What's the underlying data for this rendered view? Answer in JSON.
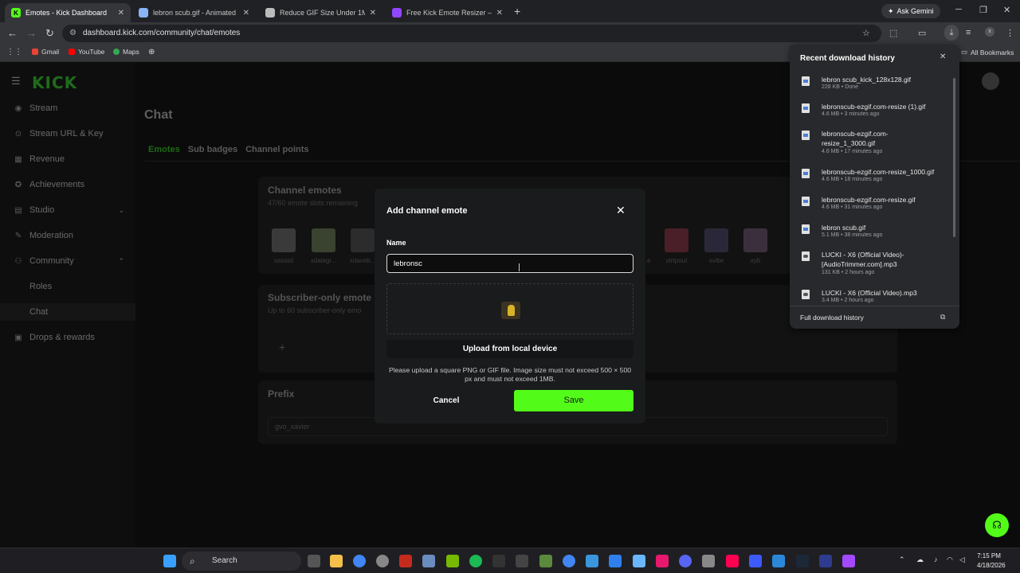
{
  "browser": {
    "tabs": [
      {
        "title": "Emotes - Kick Dashboard",
        "icon": "kick-icon",
        "active": true
      },
      {
        "title": "lebron scub.gif - Animated ima",
        "icon": "ezgif-icon",
        "active": false
      },
      {
        "title": "Reduce GIF Size Under 1MB",
        "icon": "tool-icon",
        "active": false
      },
      {
        "title": "Free Kick Emote Resizer – Resiz",
        "icon": "twitch-style-icon",
        "active": false
      }
    ],
    "ask_gemini": "Ask Gemini",
    "url": "dashboard.kick.com/community/chat/emotes",
    "bookmarks": [
      {
        "label": "Gmail"
      },
      {
        "label": "YouTube"
      },
      {
        "label": "Maps"
      }
    ],
    "all_bookmarks": "All Bookmarks"
  },
  "sidebar": {
    "items": [
      {
        "label": "Stream",
        "icon": "stream-icon"
      },
      {
        "label": "Stream URL & Key",
        "icon": "key-icon"
      },
      {
        "label": "Revenue",
        "icon": "revenue-icon"
      },
      {
        "label": "Achievements",
        "icon": "trophy-icon"
      },
      {
        "label": "Studio",
        "icon": "studio-icon"
      },
      {
        "label": "Moderation",
        "icon": "wrench-icon"
      },
      {
        "label": "Community",
        "icon": "community-icon"
      },
      {
        "label": "Roles",
        "icon": ""
      },
      {
        "label": "Chat",
        "icon": ""
      },
      {
        "label": "Drops & rewards",
        "icon": "gift-icon"
      }
    ]
  },
  "main": {
    "title": "Chat",
    "tabs": [
      "Emotes",
      "Sub badges",
      "Channel points"
    ],
    "channel_emotes": {
      "title": "Channel emotes",
      "subtitle": "47/60 emote slots remaining",
      "emotes_left": [
        {
          "label": "xassist",
          "color": "#3a3a3a"
        },
        {
          "label": "xdalegr...",
          "color": "#3a4230"
        },
        {
          "label": "xdaveb...",
          "color": "#2c2c2c"
        }
      ],
      "emotes_right": [
        {
          "label": "...e",
          "color": "#202020"
        },
        {
          "label": "xtrtpout",
          "color": "#4a1f28"
        },
        {
          "label": "xvibe",
          "color": "#2a2838"
        },
        {
          "label": "xyb",
          "color": "#3b2f3d"
        }
      ]
    },
    "subscriber_emotes": {
      "title": "Subscriber-only emote",
      "subtitle": "Up to 60 subscriber-only emo"
    },
    "prefix": {
      "title": "Prefix",
      "value": "gvo_xavier"
    }
  },
  "modal": {
    "title": "Add channel emote",
    "name_label": "Name",
    "name_value": "lebronsc",
    "upload_label": "Upload from local device",
    "hint": "Please upload a square PNG or GIF file. Image size must not exceed 500 × 500 px and must not exceed 1MB.",
    "cancel_label": "Cancel",
    "save_label": "Save"
  },
  "downloads": {
    "title": "Recent download history",
    "items": [
      {
        "name": "lebron scub_kick_128x128.gif",
        "meta": "228 KB • Done",
        "type": "image"
      },
      {
        "name": "lebronscub-ezgif.com-resize (1).gif",
        "meta": "4.6 MB • 3 minutes ago",
        "type": "image"
      },
      {
        "name": "lebronscub-ezgif.com-resize_1_3000.gif",
        "meta": "4.6 MB • 17 minutes ago",
        "type": "image"
      },
      {
        "name": "lebronscub-ezgif.com-resize_1000.gif",
        "meta": "4.6 MB • 18 minutes ago",
        "type": "image"
      },
      {
        "name": "lebronscub-ezgif.com-resize.gif",
        "meta": "4.6 MB • 31 minutes ago",
        "type": "image"
      },
      {
        "name": "lebron scub.gif",
        "meta": "5.1 MB • 38 minutes ago",
        "type": "image"
      },
      {
        "name": "LUCKI - X6 (Official Video)-[AudioTrimmer.com].mp3",
        "meta": "131 KB • 2 hours ago",
        "type": "audio"
      },
      {
        "name": "LUCKI - X6 (Official Video).mp3",
        "meta": "3.4 MB • 2 hours ago",
        "type": "audio"
      }
    ],
    "footer": "Full download history"
  },
  "taskbar": {
    "search_label": "Search",
    "time": "7:15 PM",
    "date": "4/18/2026"
  }
}
